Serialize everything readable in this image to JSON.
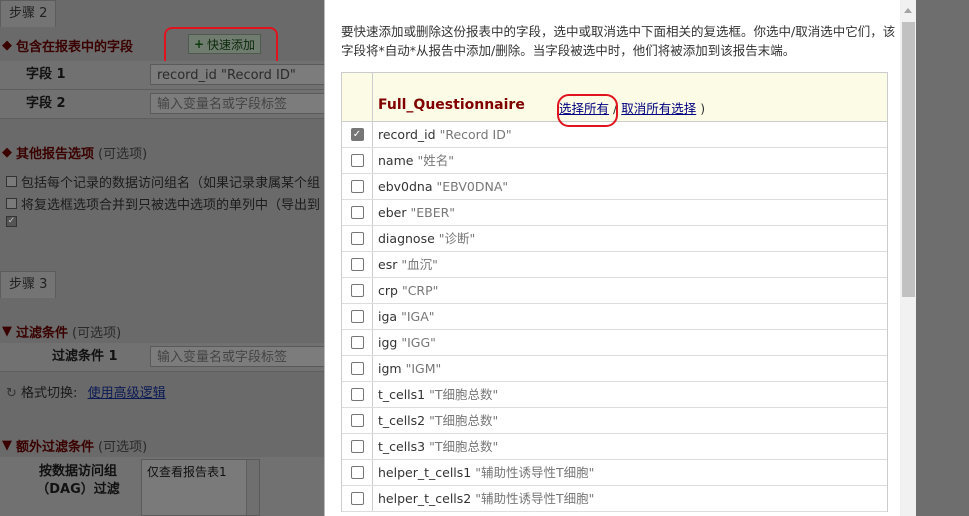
{
  "background": {
    "step2_tab": "步骤 2",
    "include_section": {
      "title": "包含在报表中的字段"
    },
    "quick_add_label": "快速添加",
    "field_rows": [
      {
        "label": "字段 1",
        "value": "record_id \"Record ID\""
      },
      {
        "label": "字段 2",
        "placeholder": "输入变量名或字段标签"
      }
    ],
    "other_options": {
      "title": "其他报告选项",
      "optional": "(可选项)"
    },
    "options": [
      {
        "text": "包括每个记录的数据访问组名（如果记录隶属某个组",
        "checked": false
      },
      {
        "text": "将复选框选项合并到只被选中选项的单列中（导出到",
        "checked": false
      },
      {
        "text": "",
        "checked": true
      }
    ],
    "step3_tab": "步骤 3",
    "filter_section": {
      "title": "过滤条件",
      "optional": "(可选项)"
    },
    "filter_row": {
      "label": "过滤条件 1",
      "placeholder": "输入变量名或字段标签"
    },
    "format_switch": {
      "label": "格式切换:",
      "link": "使用高级逻辑"
    },
    "extra_filter": {
      "title": "额外过滤条件",
      "optional": "(可选项)"
    },
    "dag_filter": {
      "label_line1": "按数据访问组",
      "label_line2": "（DAG）过滤",
      "list_item": "仅查看报告表1"
    }
  },
  "modal": {
    "instructions": "要快速添加或删除这份报表中的字段，选中或取消选中下面相关的复选框。你选中/取消选中它们，该字段将*自动*从报告中添加/删除。当字段被选中时，他们将被添加到该报告末端。",
    "form_name": "Full_Questionnaire",
    "select_all": "选择所有",
    "separator": "/",
    "deselect_all": "取消所有选择",
    "close_paren": ")",
    "fields": [
      {
        "name": "record_id",
        "label": "\"Record ID\"",
        "checked": true
      },
      {
        "name": "name",
        "label": "\"姓名\"",
        "checked": false
      },
      {
        "name": "ebv0dna",
        "label": "\"EBV0DNA\"",
        "checked": false
      },
      {
        "name": "eber",
        "label": "\"EBER\"",
        "checked": false
      },
      {
        "name": "diagnose",
        "label": "\"诊断\"",
        "checked": false
      },
      {
        "name": "esr",
        "label": "\"血沉\"",
        "checked": false
      },
      {
        "name": "crp",
        "label": "\"CRP\"",
        "checked": false
      },
      {
        "name": "iga",
        "label": "\"IGA\"",
        "checked": false
      },
      {
        "name": "igg",
        "label": "\"IGG\"",
        "checked": false
      },
      {
        "name": "igm",
        "label": "\"IGM\"",
        "checked": false
      },
      {
        "name": "t_cells1",
        "label": "\"T细胞总数\"",
        "checked": false
      },
      {
        "name": "t_cells2",
        "label": "\"T细胞总数\"",
        "checked": false
      },
      {
        "name": "t_cells3",
        "label": "\"T细胞总数\"",
        "checked": false
      },
      {
        "name": "helper_t_cells1",
        "label": "\"辅助性诱导性T细胞\"",
        "checked": false
      },
      {
        "name": "helper_t_cells2",
        "label": "\"辅助性诱导性T细胞\"",
        "checked": false
      }
    ]
  },
  "colors": {
    "form_name": "#800000",
    "link": "#000080",
    "annotation": "#e0141e",
    "table_header_bg": "#fcfce6"
  }
}
